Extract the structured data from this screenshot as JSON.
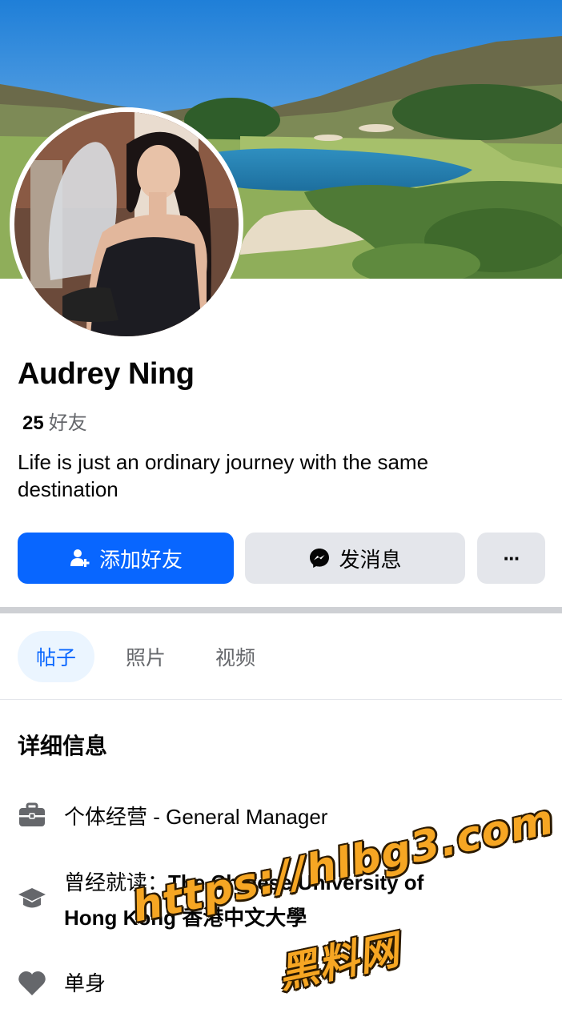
{
  "profile": {
    "name": "Audrey Ning",
    "friends_count": "25",
    "friends_label": "好友",
    "bio": "Life is just an ordinary journey with the same destination"
  },
  "actions": {
    "add_friend": "添加好友",
    "message": "发消息",
    "more": "···"
  },
  "tabs": [
    {
      "label": "帖子",
      "active": true
    },
    {
      "label": "照片",
      "active": false
    },
    {
      "label": "视频",
      "active": false
    }
  ],
  "details": {
    "title": "详细信息",
    "work": "个体经营 - General Manager",
    "education_prefix": "曾经就读：",
    "education_school_line1": "The Chinese University of",
    "education_school_line2": "Hong Kong 香港中文大學",
    "relationship": "单身"
  },
  "watermark": {
    "line1": "https://hlbg3.com",
    "line2": "黑料网"
  },
  "colors": {
    "primary": "#0866ff",
    "secondary_button": "#e4e6eb",
    "active_tab_bg": "#ebf5ff",
    "icon_gray": "#65676b"
  }
}
